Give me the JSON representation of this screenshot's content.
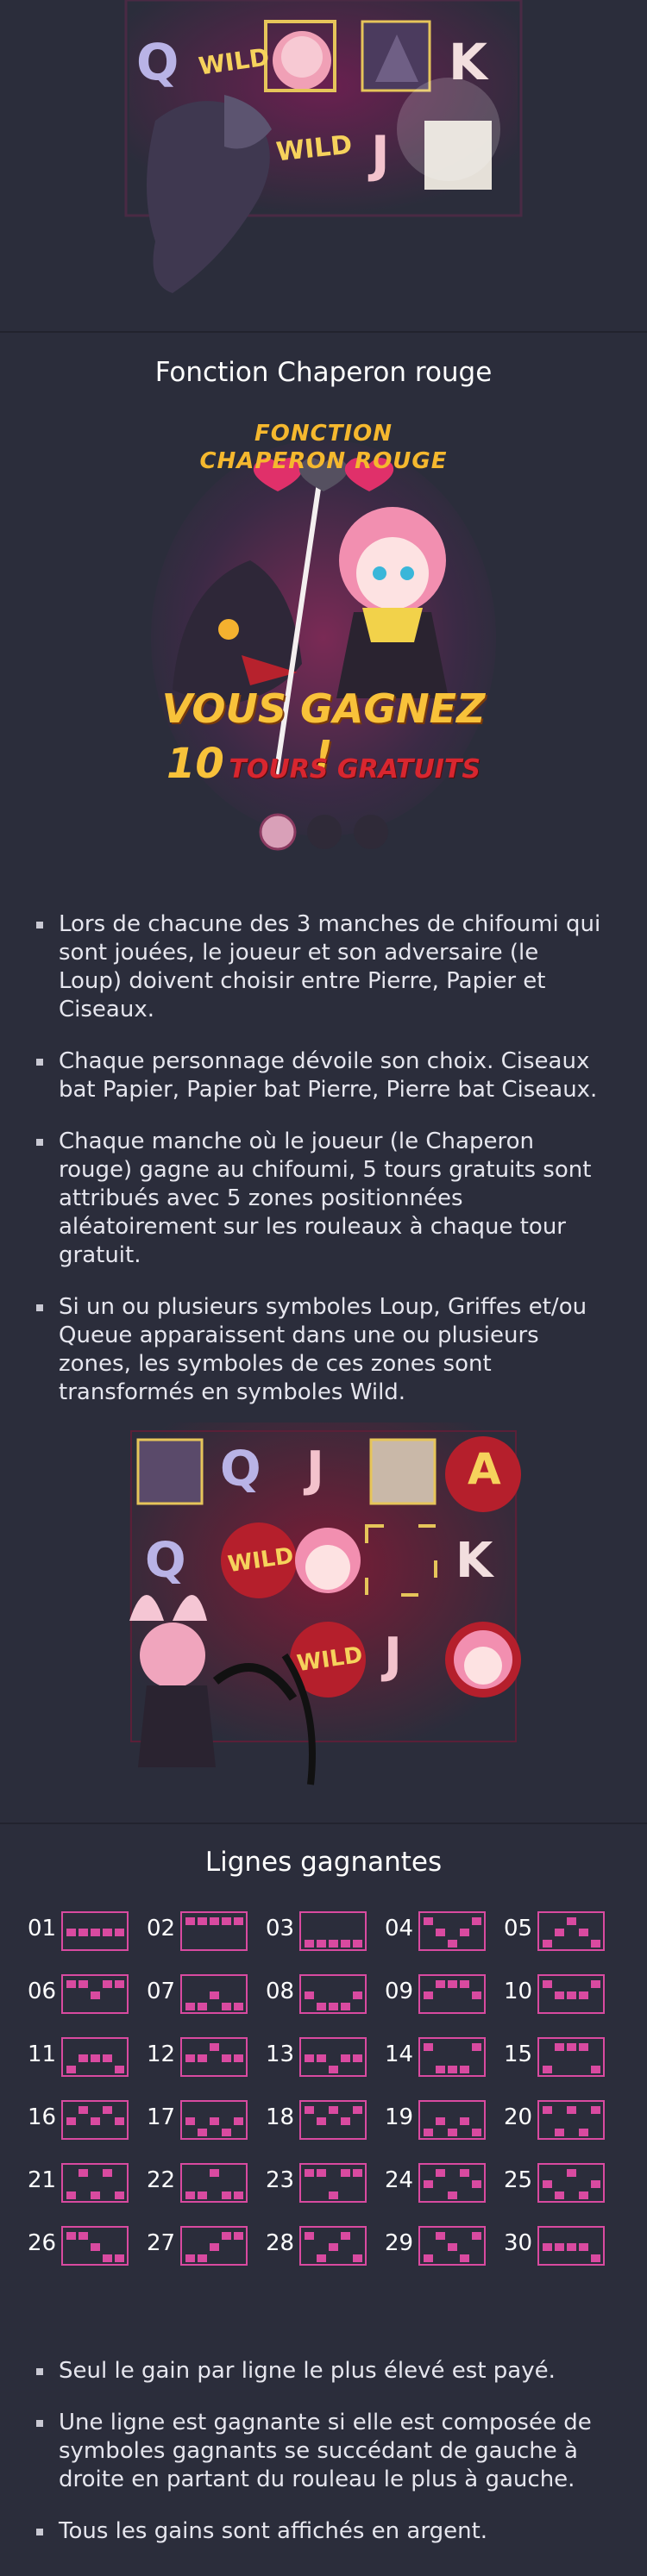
{
  "red_riding_hood": {
    "title": "Fonction Chaperon rouge",
    "banner": {
      "line1": "FONCTION",
      "line2": "CHAPERON ROUGE",
      "win_line1": "VOUS GAGNEZ !",
      "win_count": "10",
      "win_line2": "TOURS GRATUITS"
    },
    "bullets": [
      "Lors de chacune des 3 manches de chifoumi qui sont jouées, le joueur et son adversaire (le Loup) doivent choisir entre Pierre, Papier et Ciseaux.",
      "Chaque personnage dévoile son choix. Ciseaux bat Papier, Papier bat Pierre, Pierre bat Ciseaux.",
      "Chaque manche où le joueur (le Chaperon rouge) gagne au chifoumi, 5 tours gratuits sont attribués avec 5 zones positionnées aléatoirement sur les rouleaux à chaque tour gratuit.",
      "Si un ou plusieurs symboles Loup, Griffes et/ou Queue apparaissent dans une ou plusieurs zones, les symboles de ces zones sont transformés en symboles Wild."
    ]
  },
  "top_reels": {
    "symbols": [
      "Q",
      "WILD",
      "K",
      "WILD",
      "J"
    ]
  },
  "mid_reels": {
    "symbols": [
      "Q",
      "J",
      "A",
      "Q",
      "WILD",
      "K",
      "WILD",
      "J"
    ]
  },
  "paylines": {
    "title": "Lignes gagnantes",
    "lines": [
      {
        "num": "01",
        "rows": [
          1,
          1,
          1,
          1,
          1
        ]
      },
      {
        "num": "02",
        "rows": [
          0,
          0,
          0,
          0,
          0
        ]
      },
      {
        "num": "03",
        "rows": [
          2,
          2,
          2,
          2,
          2
        ]
      },
      {
        "num": "04",
        "rows": [
          0,
          1,
          2,
          1,
          0
        ]
      },
      {
        "num": "05",
        "rows": [
          2,
          1,
          0,
          1,
          2
        ]
      },
      {
        "num": "06",
        "rows": [
          0,
          0,
          1,
          0,
          0
        ]
      },
      {
        "num": "07",
        "rows": [
          2,
          2,
          1,
          2,
          2
        ]
      },
      {
        "num": "08",
        "rows": [
          1,
          2,
          2,
          2,
          1
        ]
      },
      {
        "num": "09",
        "rows": [
          1,
          0,
          0,
          0,
          1
        ]
      },
      {
        "num": "10",
        "rows": [
          0,
          1,
          1,
          1,
          0
        ]
      },
      {
        "num": "11",
        "rows": [
          2,
          1,
          1,
          1,
          2
        ]
      },
      {
        "num": "12",
        "rows": [
          1,
          1,
          0,
          1,
          1
        ]
      },
      {
        "num": "13",
        "rows": [
          1,
          1,
          2,
          1,
          1
        ]
      },
      {
        "num": "14",
        "rows": [
          0,
          2,
          2,
          2,
          0
        ]
      },
      {
        "num": "15",
        "rows": [
          2,
          0,
          0,
          0,
          2
        ]
      },
      {
        "num": "16",
        "rows": [
          1,
          0,
          1,
          0,
          1
        ]
      },
      {
        "num": "17",
        "rows": [
          1,
          2,
          1,
          2,
          1
        ]
      },
      {
        "num": "18",
        "rows": [
          0,
          1,
          0,
          1,
          0
        ]
      },
      {
        "num": "19",
        "rows": [
          2,
          1,
          2,
          1,
          2
        ]
      },
      {
        "num": "20",
        "rows": [
          0,
          2,
          0,
          2,
          0
        ]
      },
      {
        "num": "21",
        "rows": [
          2,
          0,
          2,
          0,
          2
        ]
      },
      {
        "num": "22",
        "rows": [
          2,
          2,
          0,
          2,
          2
        ]
      },
      {
        "num": "23",
        "rows": [
          0,
          0,
          2,
          0,
          0
        ]
      },
      {
        "num": "24",
        "rows": [
          1,
          0,
          2,
          0,
          1
        ]
      },
      {
        "num": "25",
        "rows": [
          1,
          2,
          0,
          2,
          1
        ]
      },
      {
        "num": "26",
        "rows": [
          0,
          0,
          1,
          2,
          2
        ]
      },
      {
        "num": "27",
        "rows": [
          2,
          2,
          1,
          0,
          0
        ]
      },
      {
        "num": "28",
        "rows": [
          0,
          2,
          1,
          0,
          2
        ]
      },
      {
        "num": "29",
        "rows": [
          2,
          0,
          1,
          2,
          0
        ]
      },
      {
        "num": "30",
        "rows": [
          1,
          1,
          1,
          1,
          2
        ]
      }
    ],
    "notes": [
      "Seul le gain par ligne le plus élevé est payé.",
      "Une ligne est gagnante si elle est composée de symboles gagnants se succédant de gauche à droite en partant du rouleau le plus à gauche.",
      "Tous les gains sont affichés en argent."
    ]
  },
  "colors": {
    "background": "#2b2d3b",
    "accent_pink": "#d94aa0",
    "banner_gold": "#f5b82e",
    "banner_red": "#d8262f"
  }
}
